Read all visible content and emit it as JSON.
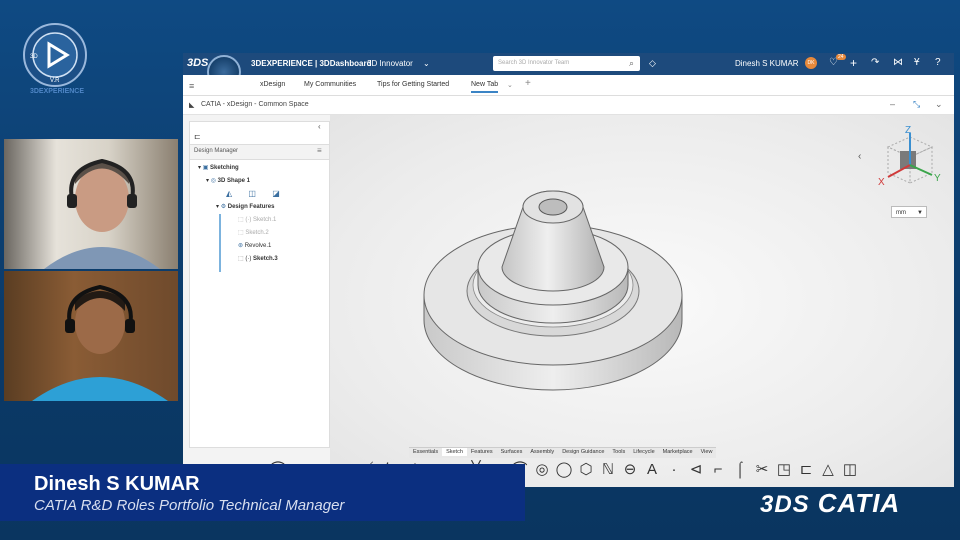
{
  "brand": {
    "logo_caption": "3DEXPERIENCE",
    "compass_label": "V.R"
  },
  "topbar": {
    "title": "3DEXPERIENCE | 3DDashboard",
    "role": "3D Innovator",
    "search_placeholder": "Search 3D Innovator Team",
    "user_name": "Dinesh S KUMAR",
    "user_initials": "DK",
    "notification_count": "24"
  },
  "tabs": [
    {
      "label": "xDesign"
    },
    {
      "label": "My Communities"
    },
    {
      "label": "Tips for Getting Started"
    },
    {
      "label": "New Tab"
    }
  ],
  "window": {
    "title": "CATIA - xDesign - Common Space"
  },
  "tree": {
    "header": "Design Manager",
    "items": [
      {
        "label": "Sketching"
      },
      {
        "label": "3D Shape 1"
      },
      {
        "label": "Design Features"
      },
      {
        "label": "Sketch.1"
      },
      {
        "label": "Sketch.2"
      },
      {
        "label": "Revolve.1"
      },
      {
        "label": "Sketch.3"
      }
    ]
  },
  "compass_axes": {
    "z": "Z",
    "x": "X",
    "y": "Y"
  },
  "units": {
    "selected": "mm"
  },
  "toolbar_tabs": [
    {
      "label": "Essentials"
    },
    {
      "label": "Sketch"
    },
    {
      "label": "Features"
    },
    {
      "label": "Surfaces"
    },
    {
      "label": "Assembly"
    },
    {
      "label": "Design Guidance"
    },
    {
      "label": "Tools"
    },
    {
      "label": "Lifecycle"
    },
    {
      "label": "Marketplace"
    },
    {
      "label": "View"
    }
  ],
  "lower_third": {
    "name": "Dinesh S KUMAR",
    "role": "CATIA R&D Roles Portfolio Technical Manager"
  },
  "catia_logo": "CATIA",
  "colors": {
    "topbar": "#1d4a7c",
    "lower_third": "#0b2f80",
    "accent": "#3b84c5"
  }
}
